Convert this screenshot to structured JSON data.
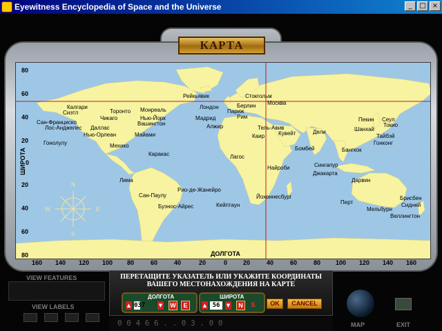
{
  "window": {
    "title": "Eyewitness Encyclopedia of Space and the Universe",
    "buttons": [
      "_",
      "□",
      "×"
    ]
  },
  "map": {
    "title": "КАРТА",
    "lat_axis_title": "ШИРОТА",
    "lon_axis_title": "ДОЛГОТА",
    "lat_ticks": [
      "80",
      "60",
      "40",
      "20",
      "0",
      "20",
      "40",
      "60",
      "80"
    ],
    "lon_ticks": [
      "160",
      "140",
      "120",
      "100",
      "80",
      "60",
      "40",
      "20",
      "0",
      "20",
      "40",
      "60",
      "80",
      "100",
      "120",
      "140",
      "160"
    ],
    "compass": {
      "N": "N",
      "S": "S",
      "E": "E",
      "W": "W"
    },
    "cities": [
      "Рейкьявик",
      "Стокгольм",
      "Москва",
      "Лондон",
      "Берлин",
      "Париж",
      "Мадрид",
      "Рим",
      "Алжир",
      "Калгари",
      "Сиэтл",
      "Сан-Франциско",
      "Лос-Анджелес",
      "Торонто",
      "Монреаль",
      "Чикаго",
      "Нью-Йорк",
      "Вашингтон",
      "Даллас",
      "Нью-Орлеан",
      "Майами",
      "Мехико",
      "Гонолулу",
      "Каракас",
      "Лима",
      "Сан-Паулу",
      "Рио-де-Жанейро",
      "Буэнос-Айрес",
      "Каир",
      "Тель-Авив",
      "Кувейт",
      "Дели",
      "Бомбей",
      "Лагос",
      "Найроби",
      "Кейптаун",
      "Йоханнесбург",
      "Пекин",
      "Сеул",
      "Шанхай",
      "Токио",
      "Тайбэй",
      "Гонконг",
      "Бангкок",
      "Сингапур",
      "Джакарта",
      "Дарвин",
      "Перт",
      "Брисбен",
      "Сидней",
      "Мельбурн",
      "Веллингтон"
    ]
  },
  "controls": {
    "instruction_line1": "ПЕРЕТАЩИТЕ УКАЗАТЕЛЬ ИЛИ УКАЖИТЕ КООРДИНАТЫ",
    "instruction_line2": "ВАШЕГО МЕСТОНАХОЖДЕНИЯ НА КАРТЕ",
    "longitude_label": "ДОЛГОТА",
    "latitude_label": "ШИРОТА",
    "longitude_value": "037",
    "longitude_dir": "W",
    "longitude_dir_alt": "E",
    "latitude_value": "56",
    "latitude_dir": "N",
    "latitude_dir_alt": "S",
    "ok_label": "OK",
    "cancel_label": "CANCEL",
    "view_features": "VIEW FEATURES",
    "view_labels": "VIEW LABELS",
    "map_label": "MAP",
    "exit_label": "EXIT",
    "bottom_strip": "0 0 4 6 6 . . 0 3 . 0 0"
  },
  "colors": {
    "ocean": "#9ec7e6",
    "land": "#f7f3a0",
    "crosshair": "#c01818",
    "plaque": "#d8a030"
  }
}
